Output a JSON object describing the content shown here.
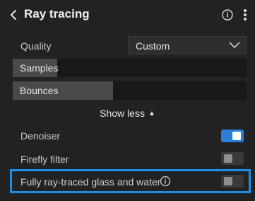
{
  "header": {
    "title": "Ray tracing"
  },
  "quality": {
    "label": "Quality",
    "value": "Custom"
  },
  "samples": {
    "label": "Samples",
    "level_fraction": 0.19
  },
  "bounces": {
    "label": "Bounces",
    "level_fraction": 0.43
  },
  "show_less": {
    "label": "Show less"
  },
  "denoiser": {
    "label": "Denoiser",
    "on": true
  },
  "firefly_filter": {
    "label": "Firefly filter",
    "on": false
  },
  "glass_water": {
    "label": "Fully ray-traced glass and water",
    "on": false
  },
  "colors": {
    "accent": "#2a7fd9",
    "highlight": "#1d8fe8"
  },
  "icons": [
    "chevron-left-icon",
    "info-icon",
    "more-vertical-icon",
    "chevron-down-icon",
    "caret-up-icon"
  ]
}
